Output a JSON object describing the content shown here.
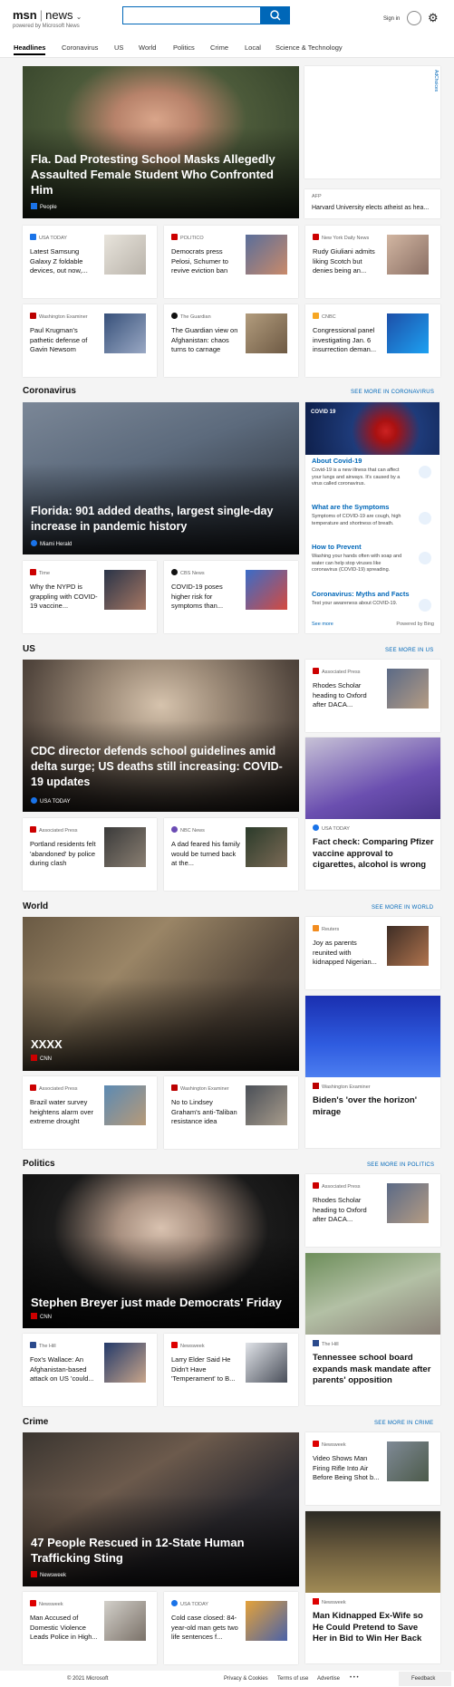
{
  "header": {
    "brand": "msn",
    "product": "news",
    "powered_by": "powered by Microsoft News",
    "search_placeholder": "",
    "sign_in": "Sign in"
  },
  "nav": [
    "Headlines",
    "Coronavirus",
    "US",
    "World",
    "Politics",
    "Crime",
    "Local",
    "Science & Technology"
  ],
  "ad_label": "AdChoices",
  "top": {
    "hero": {
      "title": "Fla. Dad Protesting School Masks Allegedly Assaulted Female Student Who Confronted Him",
      "source": "People"
    },
    "side": {
      "source": "AFP",
      "title": "Harvard University elects atheist as hea..."
    },
    "cards": [
      {
        "source": "USA TODAY",
        "title": "Latest Samsung Galaxy Z foldable devices, out now,..."
      },
      {
        "source": "POLITICO",
        "title": "Democrats press Pelosi, Schumer to revive eviction ban"
      },
      {
        "source": "New York Daily News",
        "title": "Rudy Giuliani admits liking Scotch but denies being an..."
      },
      {
        "source": "Washington Examiner",
        "title": "Paul Krugman's pathetic defense of Gavin Newsom"
      },
      {
        "source": "The Guardian",
        "title": "The Guardian view on Afghanistan: chaos turns to carnage"
      },
      {
        "source": "CNBC",
        "title": "Congressional panel investigating Jan. 6 insurrection deman..."
      }
    ]
  },
  "coronavirus": {
    "title": "Coronavirus",
    "see_more": "SEE MORE IN CORONAVIRUS",
    "hero": {
      "title": "Florida: 901 added deaths, largest single-day increase in pandemic history",
      "source": "Miami Herald"
    },
    "cards": [
      {
        "source": "Time",
        "title": "Why the NYPD is grappling with COVID-19 vaccine..."
      },
      {
        "source": "CBS News",
        "title": "COVID-19 poses higher risk for symptoms than..."
      }
    ],
    "panel": {
      "badge": "COVID 19",
      "items": [
        {
          "title": "About Covid-19",
          "desc": "Covid-19 is a new illness that can affect your lungs and airways. It's caused by a virus called coronavirus."
        },
        {
          "title": "What are the Symptoms",
          "desc": "Symptoms of COVID-19 are cough, high temperature and shortness of breath."
        },
        {
          "title": "How to Prevent",
          "desc": "Washing your hands often with soap and water can help stop viruses like coronavirus (COVID-19) spreading."
        },
        {
          "title": "Coronavirus: Myths and Facts",
          "desc": "Test your awareness about COVID-19."
        }
      ],
      "see_more": "See more",
      "powered": "Powered by Bing"
    }
  },
  "us": {
    "title": "US",
    "see_more": "SEE MORE IN US",
    "hero": {
      "title": "CDC director defends school guidelines amid delta surge; US deaths still increasing: COVID-19 updates",
      "source": "USA TODAY"
    },
    "side": {
      "source": "Associated Press",
      "title": "Rhodes Scholar heading to Oxford after DACA..."
    },
    "tall": {
      "source": "USA TODAY",
      "title": "Fact check: Comparing Pfizer vaccine approval to cigarettes, alcohol is wrong"
    },
    "cards": [
      {
        "source": "Associated Press",
        "title": "Portland residents felt 'abandoned' by police during clash"
      },
      {
        "source": "NBC News",
        "title": "A dad feared his family would be turned back at the..."
      }
    ]
  },
  "world": {
    "title": "World",
    "see_more": "SEE MORE IN WORLD",
    "hero": {
      "title": "XXXX",
      "source": "CNN"
    },
    "side": {
      "source": "Reuters",
      "title": "Joy as parents reunited with kidnapped Nigerian..."
    },
    "tall": {
      "source": "Washington Examiner",
      "title": "Biden's 'over the horizon' mirage"
    },
    "cards": [
      {
        "source": "Associated Press",
        "title": "Brazil water survey heightens alarm over extreme drought"
      },
      {
        "source": "Washington Examiner",
        "title": "No to Lindsey Graham's anti-Taliban resistance idea"
      }
    ]
  },
  "politics": {
    "title": "Politics",
    "see_more": "SEE MORE IN POLITICS",
    "hero": {
      "title": "Stephen Breyer just made Democrats' Friday",
      "source": "CNN"
    },
    "side": {
      "source": "Associated Press",
      "title": "Rhodes Scholar heading to Oxford after DACA..."
    },
    "tall": {
      "source": "The Hill",
      "title": "Tennessee school board expands mask mandate after parents' opposition"
    },
    "cards": [
      {
        "source": "The Hill",
        "title": "Fox's Wallace: An Afghanistan-based attack on US 'could..."
      },
      {
        "source": "Newsweek",
        "title": "Larry Elder Said He Didn't Have 'Temperament' to B..."
      }
    ]
  },
  "crime": {
    "title": "Crime",
    "see_more": "SEE MORE IN CRIME",
    "hero": {
      "title": "47 People Rescued in 12-State Human Trafficking Sting",
      "source": "Newsweek"
    },
    "side": {
      "source": "Newsweek",
      "title": "Video Shows Man Firing Rifle Into Air Before Being Shot b..."
    },
    "tall": {
      "source": "Newsweek",
      "title": "Man Kidnapped Ex-Wife so He Could Pretend to Save Her in Bid to Win Her Back"
    },
    "cards": [
      {
        "source": "Newsweek",
        "title": "Man Accused of Domestic Violence Leads Police in High..."
      },
      {
        "source": "USA TODAY",
        "title": "Cold case closed: 84-year-old man gets two life sentences f..."
      }
    ]
  },
  "footer": {
    "copyright": "© 2021 Microsoft",
    "links": [
      "Privacy & Cookies",
      "Terms of use",
      "Advertise"
    ],
    "more": "• • •",
    "feedback": "Feedback"
  }
}
